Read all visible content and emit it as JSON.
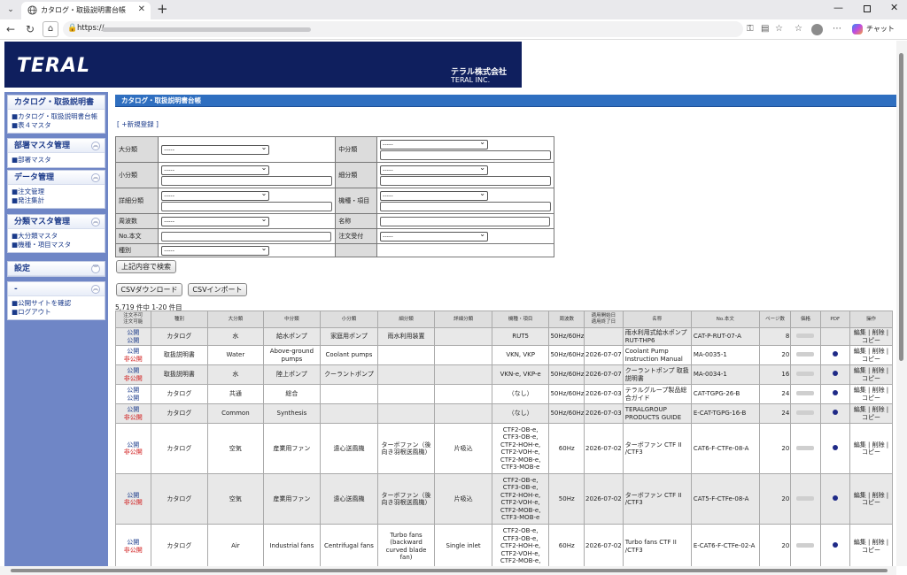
{
  "browser": {
    "tab_title": "カタログ・取扱説明書台帳",
    "url_prefix": "https://",
    "chat_label": "チャット"
  },
  "header": {
    "logo": "TERAL",
    "company_ja": "テラル株式会社",
    "company_en": "TERAL INC."
  },
  "sidebar": [
    {
      "title": "カタログ・取扱説明書",
      "items": [
        "■カタログ・取扱説明書台帳",
        "■表４マスタ"
      ],
      "chevron": ""
    },
    {
      "title": "部署マスタ管理",
      "items": [
        "■部署マスタ"
      ],
      "chevron": "︽"
    },
    {
      "title": "データ管理",
      "items": [
        "■注文管理",
        "■発注集計"
      ],
      "chevron": "︽"
    },
    {
      "title": "分類マスタ管理",
      "items": [
        "■大分類マスタ",
        "■機種・項目マスタ"
      ],
      "chevron": "︽"
    },
    {
      "title": "設定",
      "items": [],
      "chevron": "︾"
    },
    {
      "title": "-",
      "items": [
        "■公開サイトを確認",
        "■ログアウト"
      ],
      "chevron": "︽"
    }
  ],
  "main": {
    "section_title": "カタログ・取扱説明書台帳",
    "new_link": "[ +新規登録 ]",
    "search_button": "上記内容で検索",
    "csv_download": "CSVダウンロード",
    "csv_import": "CSVインポート",
    "count_text": "5,719 件中 1-20 件目",
    "select_placeholder": "-----",
    "form": {
      "daibunrui": "大分類",
      "chubunrui": "中分類",
      "shobunrui": "小分類",
      "saibunrui": "細分類",
      "shosai": "詳細分類",
      "kishu": "機種・項目",
      "shuhasu": "周波数",
      "meisho": "名称",
      "no": "No.本文",
      "chumon": "注文受付",
      "shubetsu": "種別"
    }
  },
  "table": {
    "headers": [
      "注文不可\n注文可能",
      "種別",
      "大分類",
      "中分類",
      "小分類",
      "細分類",
      "詳細分類",
      "機種・項目",
      "周波数",
      "適用開始日\n適用終了日",
      "名称",
      "No.本文",
      "ページ数",
      "価格",
      "PDF",
      "操作"
    ],
    "pub_label": "公開",
    "unpub_label": "非公開",
    "ops": [
      "編集",
      "削除",
      "コピー"
    ],
    "rows": [
      {
        "s1": "公開",
        "s2": "公開",
        "type": "カタログ",
        "dai": "水",
        "chu": "給水ポンプ",
        "sho": "家庭用ポンプ",
        "sai": "雨水利用装置",
        "shosai": "",
        "kishu": "RUT5",
        "freq": "50Hz/60Hz",
        "date": "",
        "name": "雨水利用式給水ポンプ RUT-THP6",
        "no": "CAT-P-RUT-07-A",
        "pages": "8",
        "pdf": false
      },
      {
        "s1": "公開",
        "s2": "非公開",
        "type": "取扱説明書",
        "dai": "Water",
        "chu": "Above-ground pumps",
        "sho": "Coolant pumps",
        "sai": "",
        "shosai": "",
        "kishu": "VKN, VKP",
        "freq": "50Hz/60Hz",
        "date": "2026-07-07",
        "name": "Coolant Pump Instruction Manual",
        "no": "MA-0035-1",
        "pages": "20",
        "pdf": true
      },
      {
        "s1": "公開",
        "s2": "非公開",
        "type": "取扱説明書",
        "dai": "水",
        "chu": "陸上ポンプ",
        "sho": "クーラントポンプ",
        "sai": "",
        "shosai": "",
        "kishu": "VKN-e, VKP-e",
        "freq": "50Hz/60Hz",
        "date": "2026-07-07",
        "name": "クーラントポンプ 取扱説明書",
        "no": "MA-0034-1",
        "pages": "16",
        "pdf": true
      },
      {
        "s1": "公開",
        "s2": "公開",
        "type": "カタログ",
        "dai": "共通",
        "chu": "総合",
        "sho": "",
        "sai": "",
        "shosai": "",
        "kishu": "（なし）",
        "freq": "50Hz/60Hz",
        "date": "2026-07-03",
        "name": "テラルグループ製品総合ガイド",
        "no": "CAT-TGPG-26-B",
        "pages": "24",
        "pdf": true
      },
      {
        "s1": "公開",
        "s2": "非公開",
        "type": "カタログ",
        "dai": "Common",
        "chu": "Synthesis",
        "sho": "",
        "sai": "",
        "shosai": "",
        "kishu": "（なし）",
        "freq": "50Hz/60Hz",
        "date": "2026-07-03",
        "name": "TERALGROUP PRODUCTS GUIDE",
        "no": "E-CAT-TGPG-16-B",
        "pages": "24",
        "pdf": true
      },
      {
        "s1": "公開",
        "s2": "非公開",
        "type": "カタログ",
        "dai": "空気",
        "chu": "産業用ファン",
        "sho": "遠心送風機",
        "sai": "ターボファン（後向き羽根送風機）",
        "shosai": "片吸込",
        "kishu": "CTF2-OB-e, CTF3-OB-e, CTF2-HOH-e, CTF2-VOH-e, CTF2-MOB-e, CTF3-MOB-e",
        "freq": "60Hz",
        "date": "2026-07-02",
        "name": "ターボファン CTF II /CTF3",
        "no": "CAT6-F-CTFe-08-A",
        "pages": "20",
        "pdf": true
      },
      {
        "s1": "公開",
        "s2": "非公開",
        "type": "カタログ",
        "dai": "空気",
        "chu": "産業用ファン",
        "sho": "遠心送風機",
        "sai": "ターボファン（後向き羽根送風機）",
        "shosai": "片吸込",
        "kishu": "CTF2-OB-e, CTF3-OB-e, CTF2-HOH-e, CTF2-VOH-e, CTF2-MOB-e, CTF3-MOB-e",
        "freq": "50Hz",
        "date": "2026-07-02",
        "name": "ターボファン CTF II /CTF3",
        "no": "CAT5-F-CTFe-08-A",
        "pages": "20",
        "pdf": true
      },
      {
        "s1": "公開",
        "s2": "非公開",
        "type": "カタログ",
        "dai": "Air",
        "chu": "Industrial fans",
        "sho": "Centrifugal fans",
        "sai": "Turbo fans (backward curved blade fan)",
        "shosai": "Single inlet",
        "kishu": "CTF2-OB-e, CTF3-OB-e, CTF2-HOH-e, CTF2-VOH-e, CTF2-MOB-e,",
        "freq": "60Hz",
        "date": "2026-07-02",
        "name": "Turbo fans CTF II /CTF3",
        "no": "E-CAT6-F-CTFe-02-A",
        "pages": "20",
        "pdf": true
      }
    ]
  }
}
